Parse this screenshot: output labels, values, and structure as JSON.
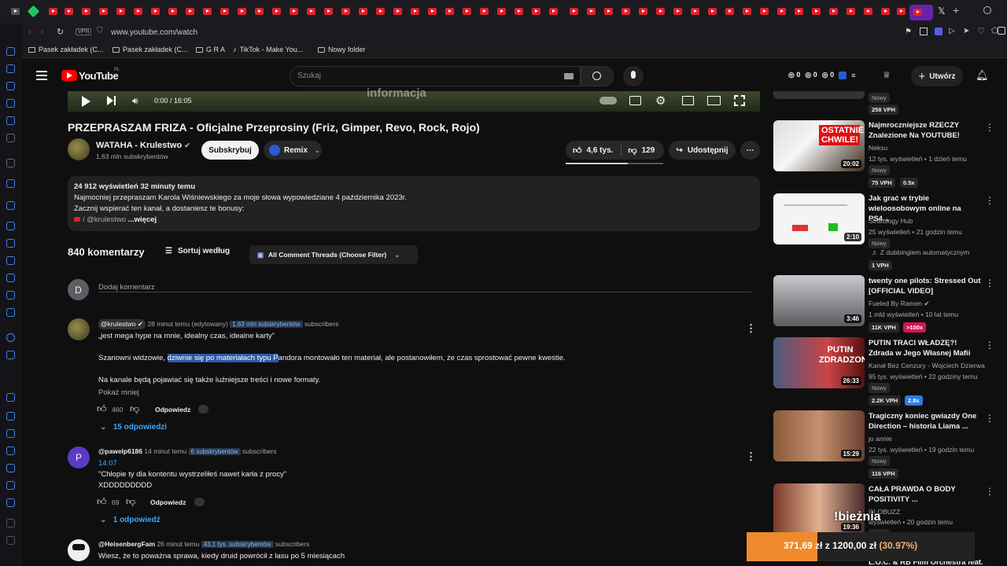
{
  "browser": {
    "url": "www.youtube.com/watch",
    "vpn_label": "VPN"
  },
  "bookmarks": [
    "Pasek zakładek (C...",
    "Pasek zakładek (C...",
    "G R A",
    "TikTok - Make You...",
    "Nowy folder"
  ],
  "yt": {
    "logo": "YouTube",
    "country": "PL",
    "search_placeholder": "Szukaj",
    "counters": [
      "0",
      "0",
      "0"
    ],
    "create_label": "Utwórz"
  },
  "player": {
    "time": "0:00 / 16:05",
    "overlay_text": "informacja"
  },
  "video": {
    "title": "PRZEPRASZAM FRIZA - Oficjalne Przeprosiny (Friz, Gimper, Revo, Rock, Rojo)",
    "channel": "WATAHA - Krulestwo",
    "subscribers": "1,63 mln subskrybentów",
    "subscribe_label": "Subskrybuj",
    "remix_label": "Remix",
    "likes": "4,6 tys.",
    "dislikes": "129",
    "share_label": "Udostępnij"
  },
  "description": {
    "stats": "24 912 wyświetleń  32 minuty temu",
    "line1": "Najmocniej przepraszam Karola Wiśniewskiego za moje słowa wypowiedziane 4 października 2023r.",
    "line2": "Zacznij wspierać ten kanał, a dostaniesz te bonusy:",
    "line3": "/ @krulestwo",
    "more": "...więcej"
  },
  "comments_header": {
    "count": "840 komentarzy",
    "sort_label": "Sortuj według",
    "filter_label": "All Comment Threads (Choose Filter)",
    "add_placeholder": "Dodaj komentarz",
    "user_initial": "D"
  },
  "comments": [
    {
      "author": "@krulestwo",
      "meta": "28 minut temu (edytowany)",
      "subs": "1,63 mln subskrybentów",
      "subs_suffix": "subscribers",
      "line1": "„jest mega hype na mnie, idealny czas, idealne karty”",
      "line2_a": "Szanowni widzowie, ",
      "line2_sel": "dziwnie się po materiałach typu P",
      "line2_b": "andora montowało ten materiał, ale postanowiłem, że czas sprostować pewne kwestie.",
      "line3": "Na kanale będą pojawiać się także luźniejsze treści i nowe formaty.",
      "show_less": "Pokaż mniej",
      "likes": "460",
      "reply_label": "Odpowiedz",
      "replies": "15 odpowiedzi"
    },
    {
      "author": "@pawelp6186",
      "meta": "14 minut temu",
      "subs": "6 subskrybentów",
      "subs_suffix": "subscribers",
      "timestamp": "14:07",
      "line1": "\"Chłopie ty dla kontentu wystrzeliłeś nawet karła z procy\"",
      "line2": "XDDDDDDDDD",
      "likes": "69",
      "reply_label": "Odpowiedz",
      "replies": "1 odpowiedź",
      "initial": "P"
    },
    {
      "author": "@HeisenbergFam",
      "meta": "26 minut temu",
      "subs": "43,1 tys. subskrybentów",
      "subs_suffix": "subscribers",
      "line1": "Wiesz, że to poważna sprawa, kiedy druid powrócił z lasu po 5 miesiącach"
    }
  ],
  "related": [
    {
      "top": "Nowy",
      "vph": "258 VPH"
    },
    {
      "title": "Najmroczniejsze RZECZY Znalezione Na YOUTUBE!",
      "channel": "Neksu",
      "meta": "12 tys. wyświetleń • 1 dzień temu",
      "badge": "Nowy",
      "vph": "75 VPH",
      "extra": "0.5x",
      "duration": "20:02",
      "thumb_text": "OSTATNIE CHWILE!"
    },
    {
      "title": "Jak grać w trybie wieloosobowym online na PS4...",
      "channel": "Stratology Hub",
      "meta": "25 wyświetleń • 21 godzin temu",
      "badge": "Nowy",
      "extra_line": "Z dubbingiem automatycznym",
      "vph": "1 VPH",
      "duration": "2:10"
    },
    {
      "title": "twenty one pilots: Stressed Out [OFFICIAL VIDEO]",
      "channel": "Fueled By Ramen",
      "meta": "1 mld wyświetleń • 10 lat temu",
      "vph": "11K VPH",
      "extra": ">100x",
      "duration": "3:46"
    },
    {
      "title": "PUTIN TRACI WŁADZĘ?! Zdrada w Jego Własnej Mafii",
      "channel": "Kanał Bez Cenzury - Wojciech Dzierwa",
      "meta": "95 tys. wyświetleń • 22 godziny temu",
      "badge": "Nowy",
      "vph": "2.2K VPH",
      "extra": "2.8x",
      "duration": "26:33",
      "thumb_text": "PUTIN ZDRADZONY!"
    },
    {
      "title": "Tragiczny koniec gwiazdy One Direction – historia Liama ...",
      "channel": "jo annie",
      "meta": "22 tys. wyświetleń • 19 godzin temu",
      "badge": "Nowy",
      "vph": "116 VPH",
      "duration": "15:29"
    },
    {
      "title": "CAŁA PRAWDA O BODY POSITIVITY ...",
      "channel": "GLOBUZZ",
      "meta": "wyświetleń • 20 godzin temu",
      "badge": "Nowy",
      "duration": "19:36"
    },
    {
      "title": "L.O.C. & RB Film Orchestra feat."
    }
  ],
  "overlay": {
    "label": "!bieżnia",
    "ticker_a": "371,69 zł",
    "ticker_sep": " z ",
    "ticker_b": "1200,00 zł",
    "ticker_pct": "(30.97%)",
    "progress": 0.3097
  },
  "colors": {
    "accent": "#3ea6ff",
    "brand_red": "#ff0000",
    "ticker_orange": "#f08a2c"
  }
}
